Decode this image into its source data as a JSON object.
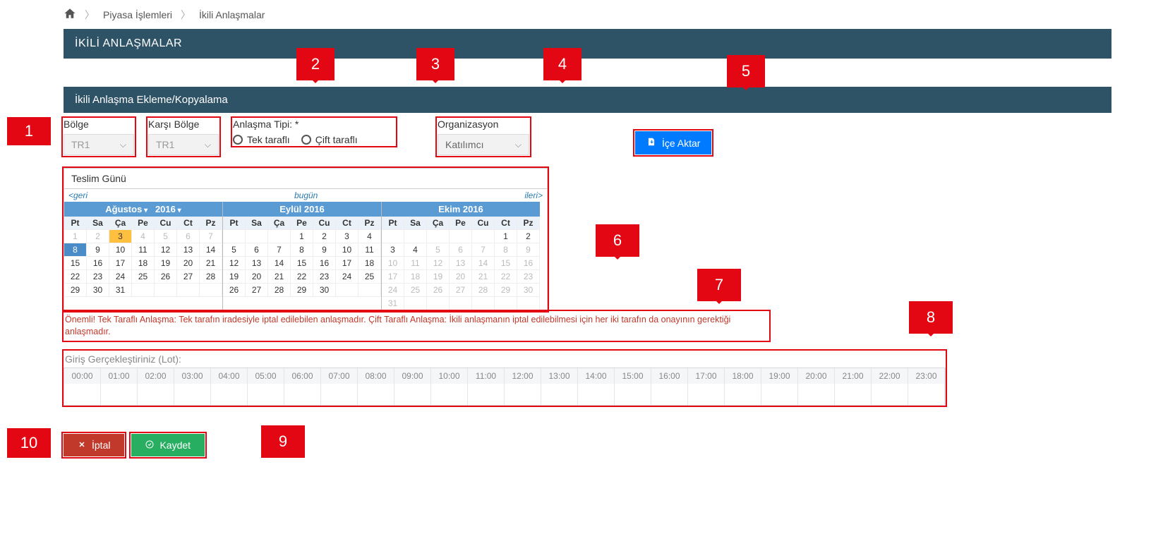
{
  "breadcrumb": {
    "item1": "Piyasa İşlemleri",
    "item2": "İkili Anlaşmalar"
  },
  "page_title": "İKİLİ ANLAŞMALAR",
  "section_title": "İkili Anlaşma Ekleme/Kopyalama",
  "filters": {
    "region_label": "Bölge",
    "region_value": "TR1",
    "counter_region_label": "Karşı Bölge",
    "counter_region_value": "TR1",
    "agreement_type_label": "Anlaşma Tipi:   *",
    "agreement_type_opt1": "Tek taraflı",
    "agreement_type_opt2": "Çift taraflı",
    "org_label": "Organizasyon",
    "org_value": "Katılımcı"
  },
  "import_btn": "İçe Aktar",
  "calendar": {
    "title": "Teslim Günü",
    "back": "<geri",
    "today": "bugün",
    "forward": "ileri>",
    "month1": "Ağustos",
    "year1": "2016",
    "month2": "Eylül 2016",
    "month3": "Ekim 2016",
    "dayheads": [
      "Pt",
      "Sa",
      "Ça",
      "Pe",
      "Cu",
      "Ct",
      "Pz"
    ],
    "m1_rows": [
      [
        "1",
        "2",
        "3",
        "4",
        "5",
        "6",
        "7"
      ],
      [
        "8",
        "9",
        "10",
        "11",
        "12",
        "13",
        "14"
      ],
      [
        "15",
        "16",
        "17",
        "18",
        "19",
        "20",
        "21"
      ],
      [
        "22",
        "23",
        "24",
        "25",
        "26",
        "27",
        "28"
      ],
      [
        "29",
        "30",
        "31",
        "",
        "",
        "",
        ""
      ]
    ],
    "m2_rows": [
      [
        "",
        "",
        "",
        "1",
        "2",
        "3",
        "4"
      ],
      [
        "5",
        "6",
        "7",
        "8",
        "9",
        "10",
        "11"
      ],
      [
        "12",
        "13",
        "14",
        "15",
        "16",
        "17",
        "18"
      ],
      [
        "19",
        "20",
        "21",
        "22",
        "23",
        "24",
        "25"
      ],
      [
        "26",
        "27",
        "28",
        "29",
        "30",
        "",
        ""
      ]
    ],
    "m3_rows": [
      [
        "",
        "",
        "",
        "",
        "",
        "1",
        "2"
      ],
      [
        "3",
        "4",
        "5",
        "6",
        "7",
        "8",
        "9"
      ],
      [
        "10",
        "11",
        "12",
        "13",
        "14",
        "15",
        "16"
      ],
      [
        "17",
        "18",
        "19",
        "20",
        "21",
        "22",
        "23"
      ],
      [
        "24",
        "25",
        "26",
        "27",
        "28",
        "29",
        "30"
      ],
      [
        "31",
        "",
        "",
        "",
        "",
        "",
        ""
      ]
    ]
  },
  "warning": "Önemli! Tek Taraflı Anlaşma: Tek tarafın iradesiyle iptal edilebilen anlaşmadır. Çift Taraflı Anlaşma: İkili anlaşmanın iptal edilebilmesi için her iki tarafın da onayının gerektiği anlaşmadır.",
  "lot": {
    "title": "Giriş Gerçekleştiriniz (Lot):",
    "hours": [
      "00:00",
      "01:00",
      "02:00",
      "03:00",
      "04:00",
      "05:00",
      "06:00",
      "07:00",
      "08:00",
      "09:00",
      "10:00",
      "11:00",
      "12:00",
      "13:00",
      "14:00",
      "15:00",
      "16:00",
      "17:00",
      "18:00",
      "19:00",
      "20:00",
      "21:00",
      "22:00",
      "23:00"
    ]
  },
  "buttons": {
    "cancel": "İptal",
    "save": "Kaydet"
  },
  "callouts": {
    "c1": "1",
    "c2": "2",
    "c3": "3",
    "c4": "4",
    "c5": "5",
    "c6": "6",
    "c7": "7",
    "c8": "8",
    "c9": "9",
    "c10": "10"
  }
}
